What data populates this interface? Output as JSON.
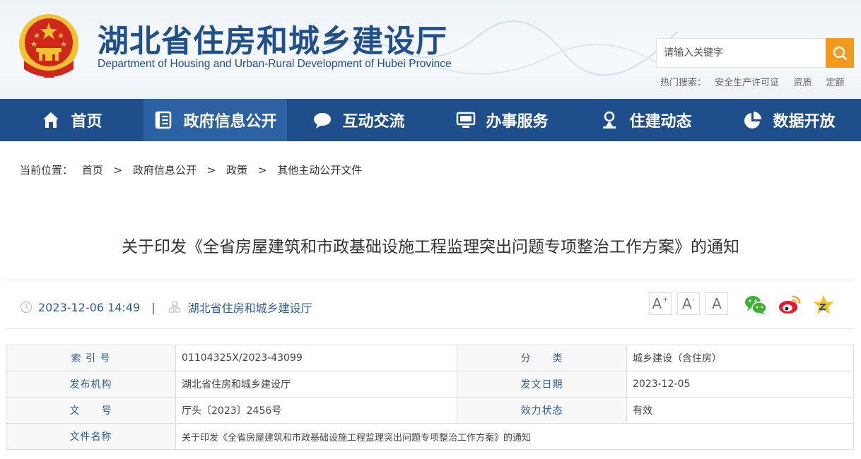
{
  "header": {
    "title": "湖北省住房和城乡建设厅",
    "subtitle": "Department of Housing and Urban-Rural Development of Hubei Province",
    "search_placeholder": "请输入关键字",
    "hot_label": "热门搜索：",
    "hot_items": [
      "安全生产许可证",
      "资质",
      "定额"
    ]
  },
  "nav": [
    {
      "label": "首页",
      "icon": "home-icon"
    },
    {
      "label": "政府信息公开",
      "icon": "document-icon",
      "active": true
    },
    {
      "label": "互动交流",
      "icon": "chat-icon"
    },
    {
      "label": "办事服务",
      "icon": "monitor-icon"
    },
    {
      "label": "住建动态",
      "icon": "pin-icon"
    },
    {
      "label": "数据开放",
      "icon": "pie-icon"
    }
  ],
  "breadcrumb": {
    "label": "当前位置：",
    "items": [
      "首页",
      "政府信息公开",
      "政策",
      "其他主动公开文件"
    ],
    "separator": ">"
  },
  "article": {
    "title": "关于印发《全省房屋建筑和市政基础设施工程监理突出问题专项整治工作方案》的通知",
    "datetime": "2023-12-06 14:49",
    "divider": "|",
    "source": "湖北省住房和城乡建设厅"
  },
  "tools": {
    "font_increase": "A",
    "font_increase_mark": "+",
    "font_decrease": "A",
    "font_decrease_mark": "-",
    "font_reset": "A"
  },
  "share_icons": [
    "wechat-icon",
    "weibo-icon",
    "favorite-icon"
  ],
  "info_table": {
    "rows": [
      [
        {
          "label": "索 引 号",
          "value": "01104325X/2023-43099"
        },
        {
          "label": "分　　类",
          "value": "城乡建设（含住房）"
        }
      ],
      [
        {
          "label": "发布机构",
          "value": "湖北省住房和城乡建设厅"
        },
        {
          "label": "发文日期",
          "value": "2023-12-05"
        }
      ],
      [
        {
          "label": "文　　号",
          "value": "厅头〔2023〕2456号"
        },
        {
          "label": "效力状态",
          "value": "有效"
        }
      ]
    ],
    "file_label": "文件名称",
    "file_value": "关于印发《全省房屋建筑和市政基础设施工程监理突出问题专项整治工作方案》的通知"
  },
  "colors": {
    "nav_bg": "#1e4f8c",
    "nav_active": "#2c62a3",
    "brand_text": "#1f4f8c",
    "search_button": "#f39a1e",
    "emblem_red": "#d0261c",
    "emblem_gold": "#f2c230"
  }
}
